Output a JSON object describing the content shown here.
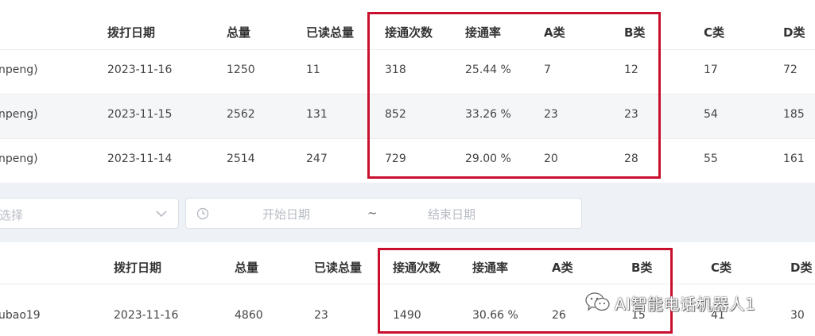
{
  "table1": {
    "headers": [
      "拨打日期",
      "总量",
      "已读总量",
      "接通次数",
      "接通率",
      "A类",
      "B类",
      "C类",
      "D类"
    ],
    "rows": [
      {
        "name": "npeng)",
        "date": "2023-11-16",
        "total": "1250",
        "read": "11",
        "connected": "318",
        "rate": "25.44 %",
        "a": "7",
        "b": "12",
        "c": "17",
        "d": "72"
      },
      {
        "name": "npeng)",
        "date": "2023-11-15",
        "total": "2562",
        "read": "131",
        "connected": "852",
        "rate": "33.26 %",
        "a": "23",
        "b": "23",
        "c": "54",
        "d": "185"
      },
      {
        "name": "npeng)",
        "date": "2023-11-14",
        "total": "2514",
        "read": "247",
        "connected": "729",
        "rate": "29.00 %",
        "a": "20",
        "b": "28",
        "c": "55",
        "d": "161"
      }
    ]
  },
  "filter": {
    "select_placeholder": "选择",
    "start_placeholder": "开始日期",
    "separator": "~",
    "end_placeholder": "结束日期"
  },
  "table2": {
    "headers": [
      "拨打日期",
      "总量",
      "已读总量",
      "接通次数",
      "接通率",
      "A类",
      "B类",
      "C类",
      "D类"
    ],
    "rows": [
      {
        "name": "ubao19",
        "date": "2023-11-16",
        "total": "4860",
        "read": "23",
        "connected": "1490",
        "rate": "30.66 %",
        "a": "26",
        "b": "15",
        "c": "41",
        "d": "30"
      }
    ]
  },
  "watermark": {
    "text": "AI智能电话机器人1",
    "icon": "wechat-icon"
  },
  "colors": {
    "highlight_border": "#c8102e",
    "stripe": "#f5f6f8",
    "filter_bar": "#eef1f6"
  }
}
